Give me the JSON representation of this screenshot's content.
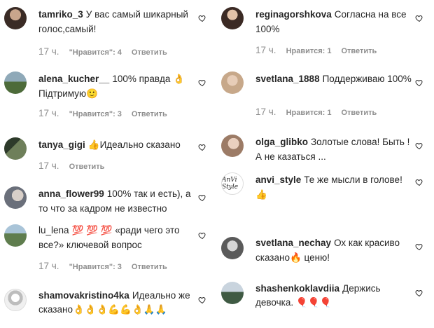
{
  "heart_icon": "heart-outline-icon",
  "colors": {
    "text": "#262626",
    "meta": "#8e8e8e"
  },
  "left": [
    {
      "user": "tamriko_3",
      "text": "У вас самый шикарный голос,самый!",
      "time": "17 ч.",
      "likes": "\"Нравится\": 4",
      "reply": "Ответить"
    },
    {
      "user": "alena_kucher__",
      "text": "100% правда 👌 Підтримую🙂",
      "time": "17 ч.",
      "likes": "\"Нравится\": 3",
      "reply": "Ответить"
    },
    {
      "user": "tanya_gigi",
      "text": "👍Идеально сказано",
      "time": "17 ч.",
      "reply": "Ответить"
    },
    {
      "user": "anna_flower99",
      "text": "100% так и есть), а то что за кадром не известно"
    },
    {
      "user": "lu_lena",
      "text": "💯 💯 💯 «ради чего это все?» ключевой вопрос",
      "time": "17 ч.",
      "likes": "\"Нравится\": 3",
      "reply": "Ответить"
    },
    {
      "user": "shamovakristino4ka",
      "text": "Идеально же сказано👌👌👌💪💪👌🙏🙏"
    }
  ],
  "right": [
    {
      "user": "reginagorshkova",
      "text": "Согласна на все 100%",
      "time": "17 ч.",
      "likes": "Нравится: 1",
      "reply": "Ответить"
    },
    {
      "user": "svetlana_1888",
      "text": "Поддерживаю 100%",
      "time": "17 ч.",
      "likes": "Нравится: 1",
      "reply": "Ответить"
    },
    {
      "user": "olga_glibko",
      "text": "Золотые слова! Быть ! А не казаться ..."
    },
    {
      "user": "anvi_style",
      "text": "Те же мысли в голове! 👍",
      "logo": "AnVi Style"
    },
    {
      "user": "svetlana_nechay",
      "text": "Ох как красиво сказано🔥 ценю!"
    },
    {
      "user": "shashenkoklavdiia",
      "text": "Держись девочка. 🎈🎈🎈"
    }
  ]
}
